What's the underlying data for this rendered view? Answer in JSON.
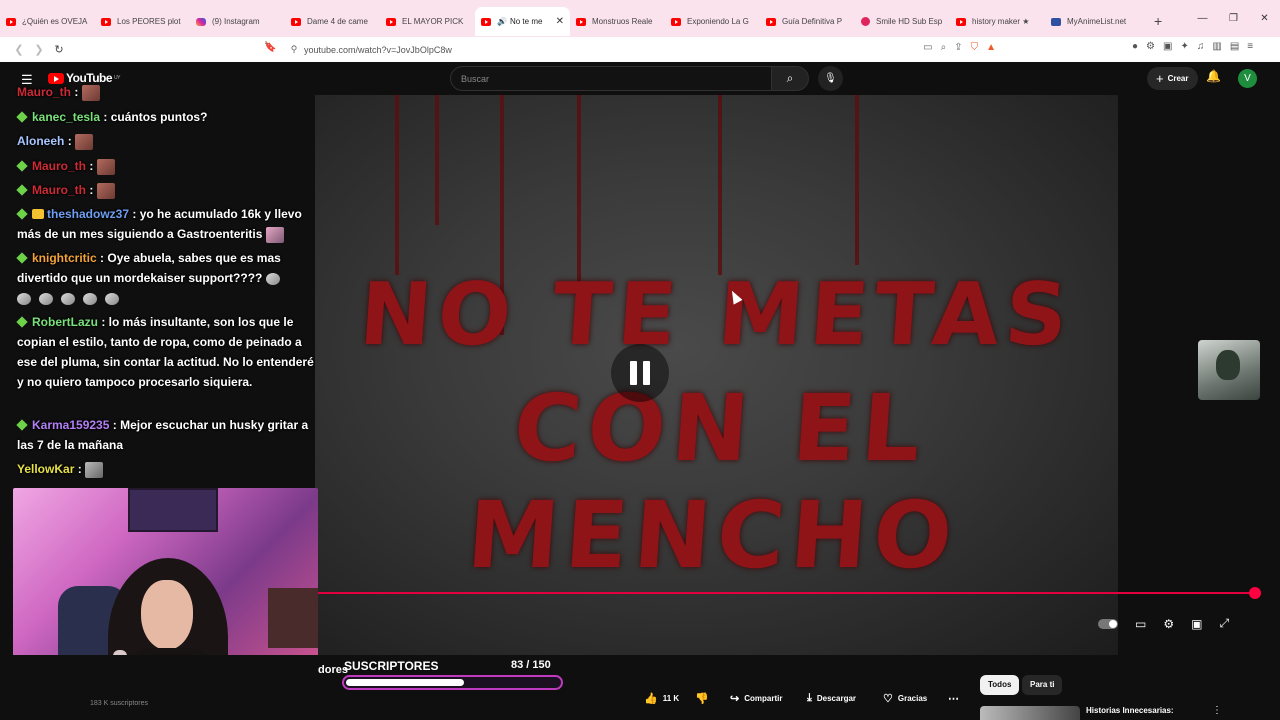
{
  "browser": {
    "tabs": [
      {
        "title": "¿Quién es OVEJA",
        "icon": "youtube-icon"
      },
      {
        "title": "Los PEORES plot",
        "icon": "youtube-icon"
      },
      {
        "title": "(9) Instagram",
        "icon": "instagram-icon"
      },
      {
        "title": "Dame 4 de came",
        "icon": "youtube-icon"
      },
      {
        "title": "EL MAYOR PICK",
        "icon": "youtube-icon"
      },
      {
        "title": "No te me",
        "icon": "youtube-icon",
        "active": true
      },
      {
        "title": "Monstruos Reale",
        "icon": "youtube-icon"
      },
      {
        "title": "Exponiendo La G",
        "icon": "youtube-icon"
      },
      {
        "title": "Guía Definitiva P",
        "icon": "youtube-icon"
      },
      {
        "title": "Smile HD Sub Esp",
        "icon": "smile-icon"
      },
      {
        "title": "history maker ★",
        "icon": "youtube-icon"
      },
      {
        "title": "MyAnimeList.net",
        "icon": "myanimelist-icon"
      }
    ],
    "url": "youtube.com/watch?v=JovJbOlpC8w"
  },
  "youtube": {
    "logo_text": "YouTube",
    "region": "UY",
    "search_placeholder": "Buscar",
    "create_label": "Crear",
    "avatar_letter": "V"
  },
  "video": {
    "title_line1": "NO TE METAS",
    "title_line2": "CON EL MENCHO",
    "progress": 0.997
  },
  "chat": [
    {
      "user": "Mauro_th",
      "color": "red",
      "text": ":",
      "emote": true
    },
    {
      "user": "kanec_tesla",
      "color": "green",
      "text": ": cuántos puntos?"
    },
    {
      "user": "Aloneeh",
      "color": "lightblue",
      "text": ":",
      "emote": true
    },
    {
      "user": "Mauro_th",
      "color": "red",
      "text": ":",
      "emote": true
    },
    {
      "user": "Mauro_th",
      "color": "red",
      "text": ":",
      "emote": true
    },
    {
      "user": "theshadowz37",
      "color": "blue",
      "text": ": yo he acumulado 16k y llevo más de un mes siguiendo a Gastroenteritis"
    },
    {
      "user": "knightcritic",
      "color": "orange",
      "text": ": Oye abuela, sabes que es mas divertido que un mordekaiser support????"
    },
    {
      "user": "RobertLazu",
      "color": "green",
      "text": ": lo más insultante, son los que le copian el estilo, tanto de ropa, como de peinado a ese del pluma, sin contar la actitud. No lo entenderé y no quiero tampoco procesarlo siquiera."
    },
    {
      "user": "Karma159235",
      "color": "purple",
      "text": ": Mejor escuchar un husky gritar a las 7 de la mañana"
    },
    {
      "user": "YellowKar",
      "color": "yellow",
      "text": ":",
      "emote": true
    }
  ],
  "subs_goal": {
    "label": "SUSCRIPTORES",
    "count": "83 / 150",
    "current": 83,
    "target": 150,
    "partial_text": "dores"
  },
  "channel": {
    "subscribers": "183 K suscriptores"
  },
  "actions": {
    "likes": "11 K",
    "share": "Compartir",
    "download": "Descargar",
    "thanks": "Gracias"
  },
  "filters": {
    "all": "Todos",
    "for_you": "Para ti"
  },
  "recommended": {
    "title": "Historias Innecesarias:"
  },
  "colors": {
    "accent": "#ff0040",
    "youtube_red": "#ff0000",
    "tabstrip": "#fbe3ee",
    "goal_border": "#c03ac0"
  }
}
